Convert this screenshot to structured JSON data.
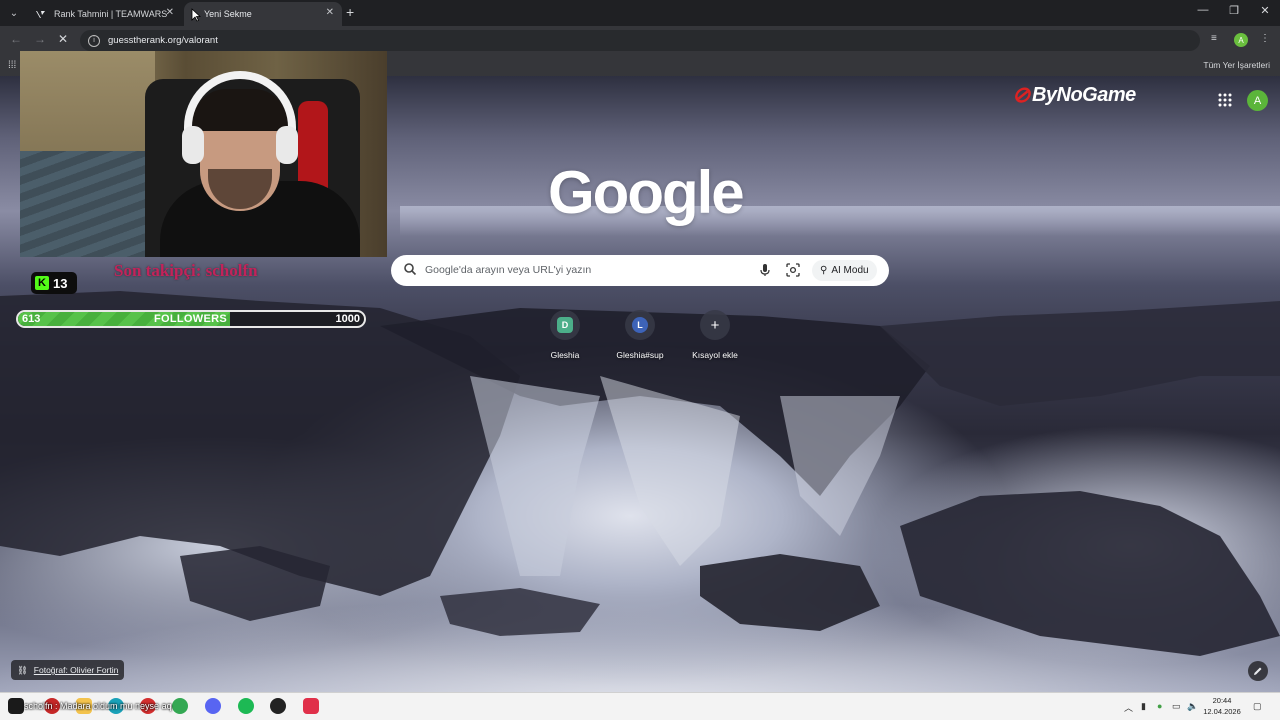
{
  "browser": {
    "tabs": [
      {
        "label": "Rank Tahmini | TEAMWARS",
        "active": false
      },
      {
        "label": "Yeni Sekme",
        "active": true
      }
    ],
    "url": "guesstherank.org/valorant",
    "bookmarks_all": "Tüm Yer İşaretleri",
    "profile_initial": "A"
  },
  "newtab": {
    "logo": "Google",
    "search_placeholder": "Google'da arayın veya URL'yi yazın",
    "ai_mode": "AI Modu",
    "shortcuts": [
      {
        "label": "Gleshia",
        "initial": "D",
        "color": "#4caf8a"
      },
      {
        "label": "Gleshia#sup",
        "initial": "L",
        "color": "#3d63b8"
      },
      {
        "label": "Kısayol ekle",
        "initial": "+",
        "color": ""
      }
    ],
    "sponsor": "ByNoGame",
    "photo_credit": "Fotoğraf: Olivier Fortin"
  },
  "stream_overlay": {
    "kick_viewers": "13",
    "last_follower": "Son takipçi: scholfn",
    "followers_current": "613",
    "followers_label": "FOLLOWERS",
    "followers_goal": "1000",
    "followers_progress": 0.613
  },
  "taskbar": {
    "ticker": "scholfn : Madara oldum mu neyse aq",
    "time": "20:44",
    "date": "12.04.2026"
  },
  "colors": {
    "kick_green": "#53fc18",
    "follower_text": "#c3235a",
    "progress_green": "#57c24a",
    "chrome_dark": "#35363a"
  }
}
